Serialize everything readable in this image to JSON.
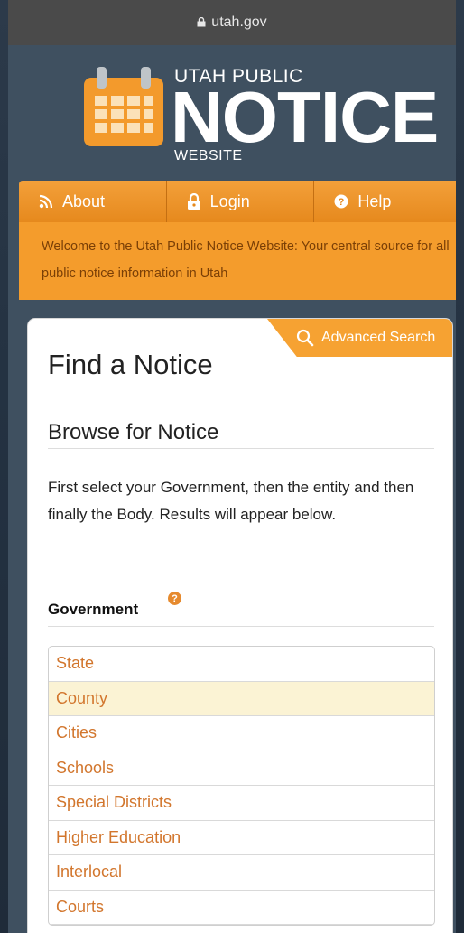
{
  "browser": {
    "url": "utah.gov"
  },
  "logo": {
    "top": "UTAH PUBLIC",
    "main": "NOTICE",
    "bottom": "WEBSITE"
  },
  "nav": {
    "about": "About",
    "login": "Login",
    "help": "Help"
  },
  "welcome": "Welcome to the Utah Public Notice Website: Your central source for all public notice information in Utah",
  "card": {
    "advanced_search": "Advanced Search",
    "title": "Find a Notice",
    "subtitle": "Browse for Notice",
    "instructions": "First select your Government, then the entity and then finally the Body. Results will appear below.",
    "government_label": "Government",
    "government_options": [
      "State",
      "County",
      "Cities",
      "Schools",
      "Special Districts",
      "Higher Education",
      "Interlocal",
      "Courts"
    ],
    "selected_option": "County"
  },
  "colors": {
    "accent": "#f49c2c",
    "link": "#d2762d",
    "selected_bg": "#fbf3d4"
  },
  "icons": [
    "lock-icon",
    "calendar-logo-icon",
    "rss-icon",
    "padlock-icon",
    "help-icon",
    "search-icon"
  ]
}
